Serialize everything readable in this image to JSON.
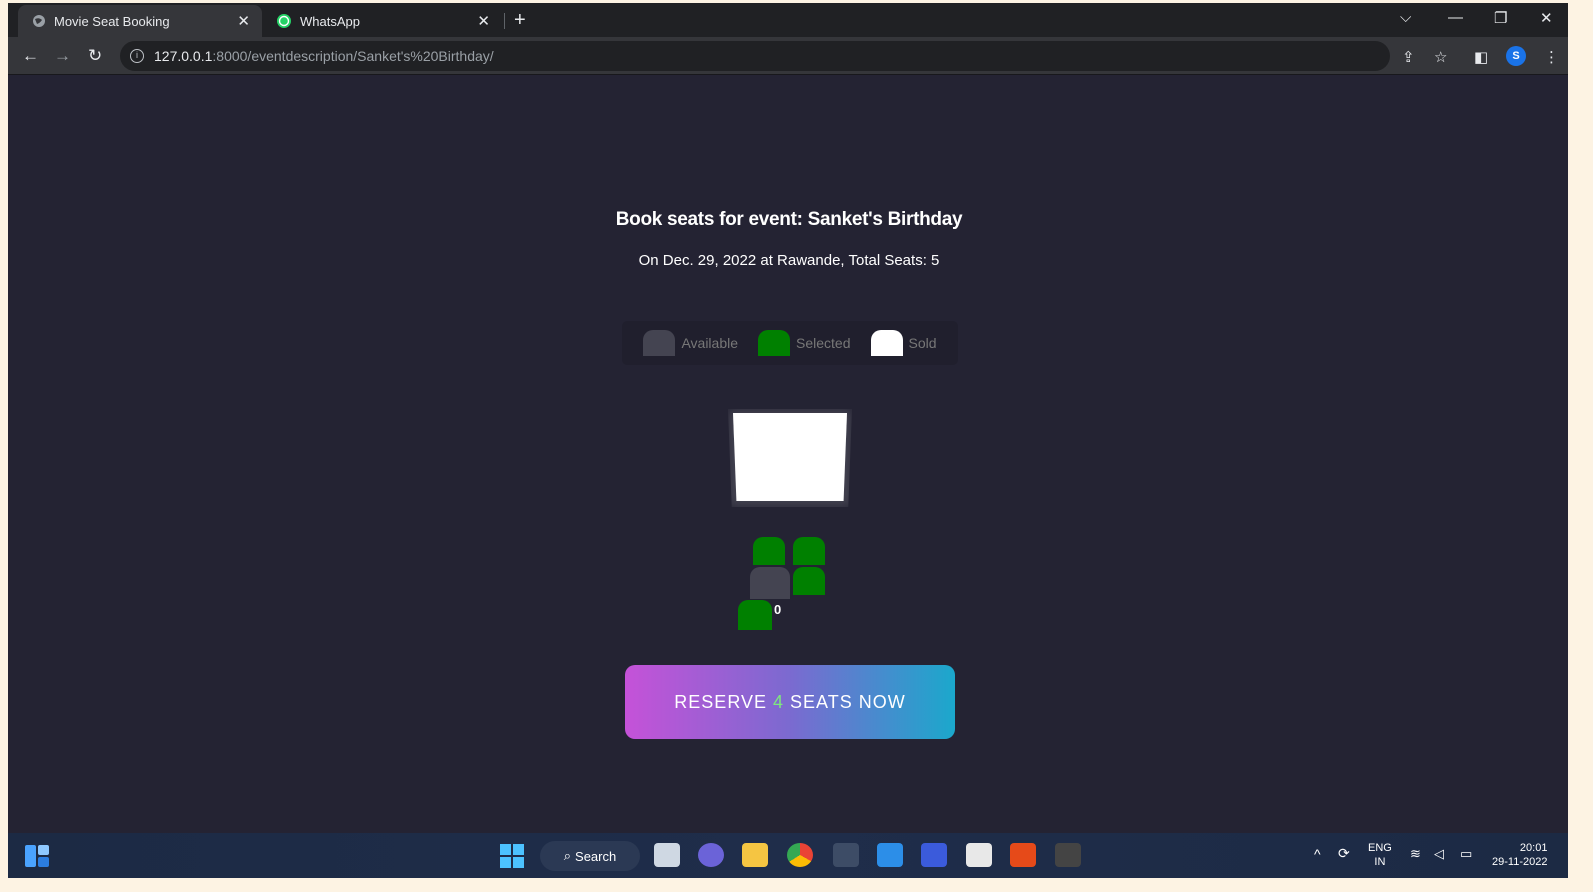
{
  "browser": {
    "tabs": [
      {
        "title": "Movie Seat Booking",
        "active": true,
        "icon": "globe-icon"
      },
      {
        "title": "WhatsApp",
        "active": false,
        "icon": "whatsapp-icon"
      }
    ],
    "new_tab": "+",
    "url_host": "127.0.0.1",
    "url_path": ":8000/eventdescription/Sanket's%20Birthday/",
    "profile_initial": "S"
  },
  "page": {
    "title": "Book seats for event: Sanket's Birthday",
    "subtitle": "On Dec. 29, 2022 at Rawande, Total Seats: 5",
    "legend": [
      {
        "label": "Available",
        "color": "#444451"
      },
      {
        "label": "Selected",
        "color": "#008000"
      },
      {
        "label": "Sold",
        "color": "#ffffff"
      }
    ],
    "seat_label": "0",
    "reserve": {
      "prefix": "RESERVE",
      "count": "4",
      "suffix": "SEATS NOW"
    }
  },
  "taskbar": {
    "search_label": "Search",
    "lang_top": "ENG",
    "lang_bottom": "IN",
    "time": "20:01",
    "date": "29-11-2022"
  },
  "colors": {
    "background": "#242333",
    "available": "#444451",
    "selected": "#008000",
    "sold": "#ffffff",
    "accent_start": "#c552d8",
    "accent_end": "#1ba8cc"
  }
}
